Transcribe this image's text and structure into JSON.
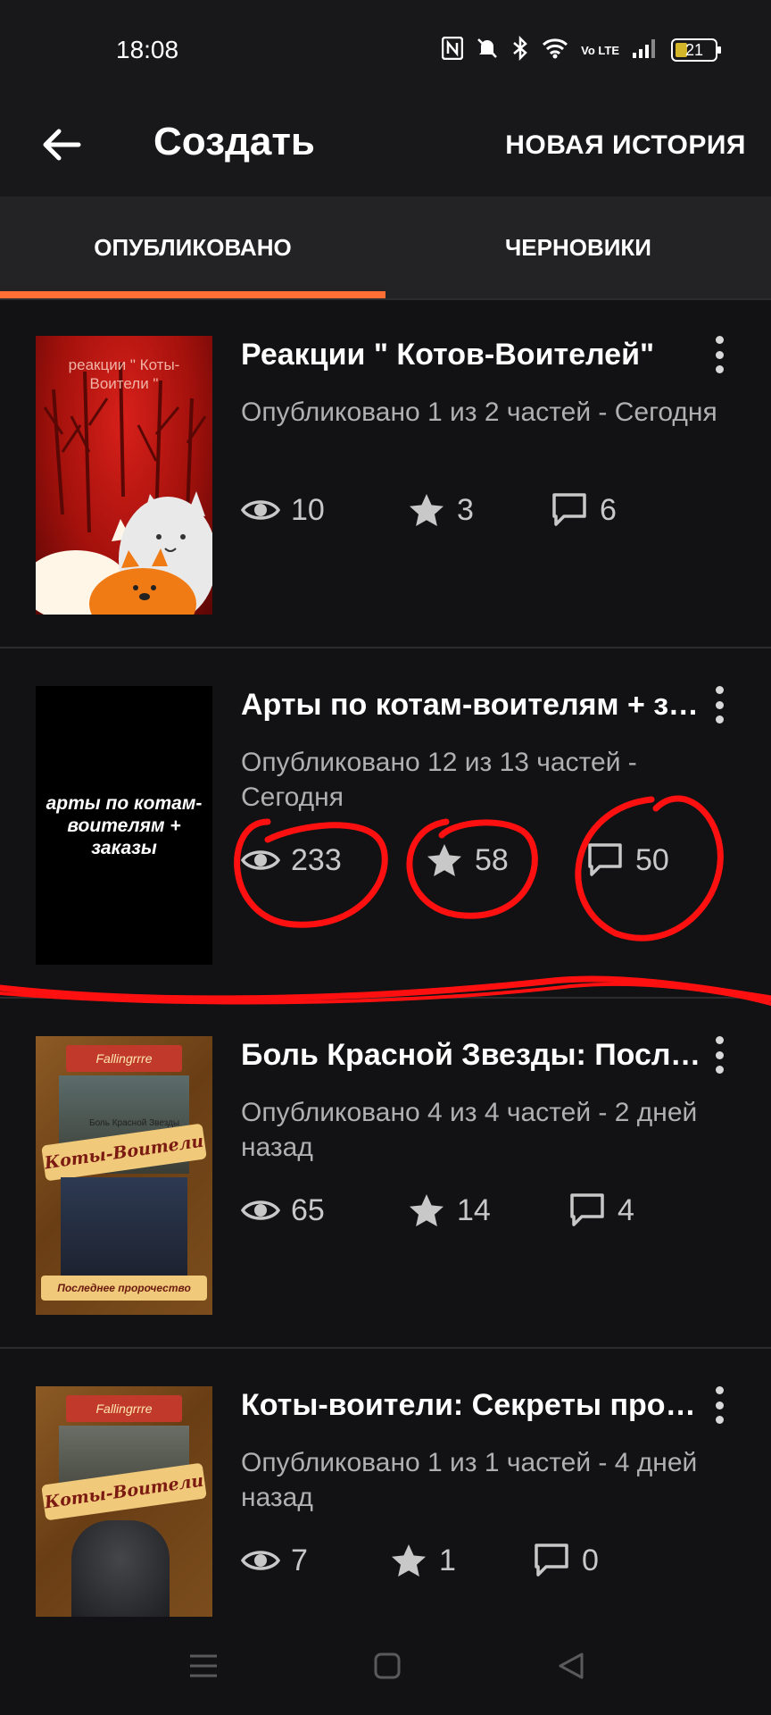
{
  "status_bar": {
    "time": "18:08",
    "battery": "21",
    "net_label": "Vo LTE"
  },
  "header": {
    "title": "Создать",
    "action": "НОВАЯ ИСТОРИЯ"
  },
  "tabs": [
    {
      "label": "ОПУБЛИКОВАНО",
      "active": true
    },
    {
      "label": "ЧЕРНОВИКИ",
      "active": false
    }
  ],
  "colors": {
    "accent": "#ff6f35",
    "annotation": "#ff1010"
  },
  "stories": [
    {
      "title": "Реакции \" Котов-Воителей\"",
      "status": "Опубликовано 1 из 2 частей - Сегодня",
      "views": "10",
      "votes": "3",
      "comments": "6",
      "cover_text": "реакции \" Коты-Воители \""
    },
    {
      "title": "Арты по котам-воителям + заказы",
      "status": "Опубликовано 12 из 13 частей - Сегодня",
      "views": "233",
      "votes": "58",
      "comments": "50",
      "cover_text": "арты по котам-воителям + заказы"
    },
    {
      "title": " Боль Красной Звезды: Последнее пророчество",
      "status": "Опубликовано 4 из 4 частей - 2 дней назад",
      "views": "65",
      "votes": "14",
      "comments": "4",
      "cover_author": "Fallingrrre",
      "cover_series": "Коты-Воители",
      "cover_sub": "Боль Красной Звезды",
      "cover_bottom": "Последнее пророчество"
    },
    {
      "title": "Коты-воители: Секреты прошлого",
      "status": "Опубликовано 1 из 1 частей - 4 дней назад",
      "views": "7",
      "votes": "1",
      "comments": "0",
      "cover_author": "Fallingrrre",
      "cover_series": "Коты-Воители"
    }
  ],
  "nav": {
    "icons": [
      "menu-icon",
      "home-icon",
      "back-icon"
    ]
  }
}
